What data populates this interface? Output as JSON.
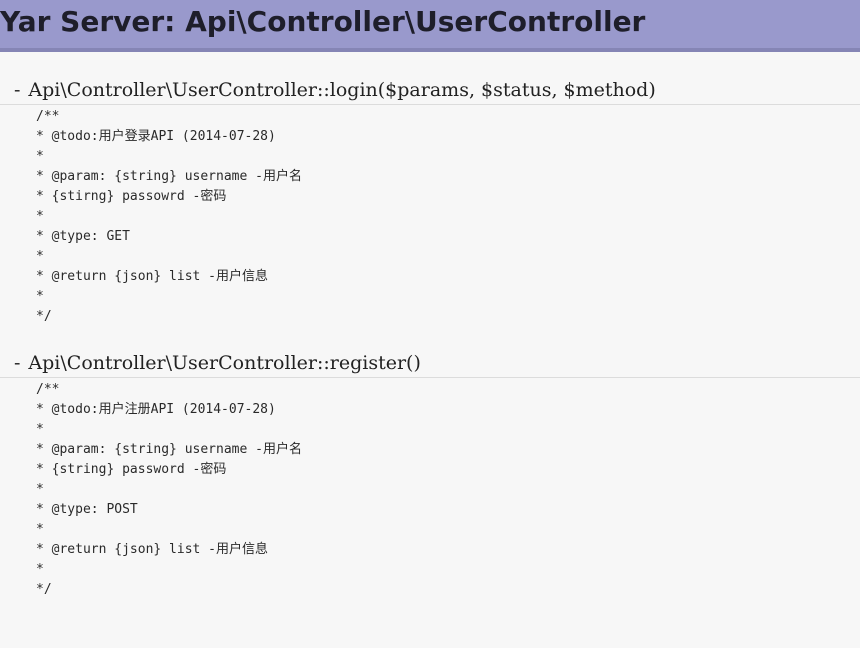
{
  "header": {
    "title": "Yar Server: Api\\Controller\\UserController",
    "background_color": "#9999cc"
  },
  "methods": [
    {
      "signature": "Api\\Controller\\UserController::login($params, $status, $method)",
      "doc_lines": [
        "/**",
        "* @todo:用户登录API (2014-07-28)",
        "*",
        "* @param: {string} username -用户名",
        "* {stirng} passowrd -密码",
        "*",
        "* @type: GET",
        "*",
        "* @return {json} list -用户信息",
        "*",
        "*/"
      ]
    },
    {
      "signature": "Api\\Controller\\UserController::register()",
      "doc_lines": [
        "/**",
        "* @todo:用户注册API (2014-07-28)",
        "*",
        "* @param: {string} username -用户名",
        "* {string} password -密码",
        "*",
        "* @type: POST",
        "*",
        "* @return {json} list -用户信息",
        "*",
        "*/"
      ]
    }
  ]
}
